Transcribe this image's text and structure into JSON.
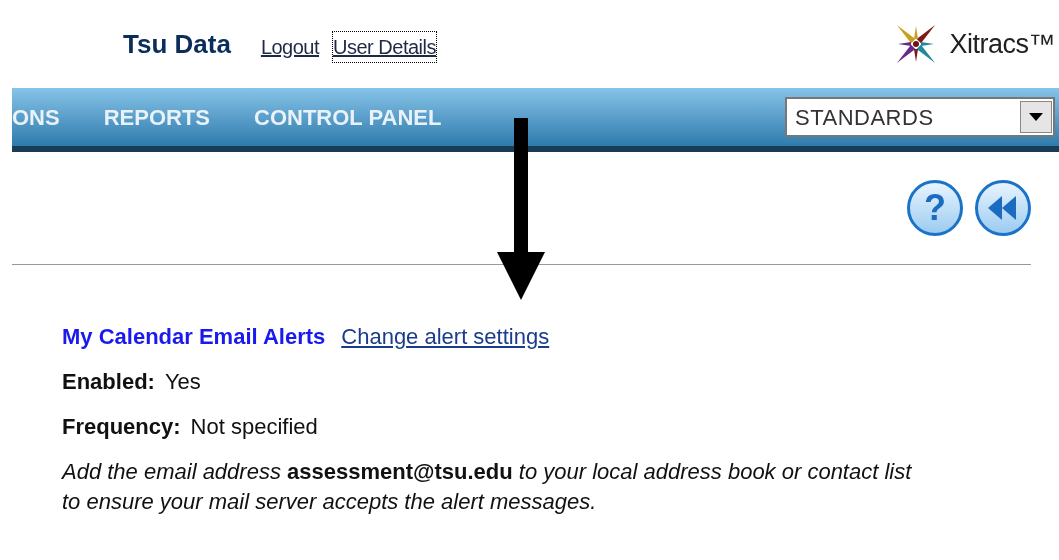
{
  "header": {
    "user": "Tsu Data",
    "links": [
      "Logout",
      "User Details"
    ],
    "logo": "Xitracs™"
  },
  "nav": {
    "items": [
      {
        "label": "ONS"
      },
      {
        "label": "REPORTS"
      },
      {
        "label": "CONTROL PANEL"
      }
    ],
    "select": {
      "value": "STANDARDS"
    }
  },
  "toolbar": {
    "buttons": [
      {
        "kind": "help",
        "label": "?"
      },
      {
        "kind": "back"
      }
    ]
  },
  "alerts": {
    "title": "My Calendar Email Alerts",
    "link": "Change alert settings",
    "fields": [
      {
        "label": "Enabled:",
        "value": "Yes"
      },
      {
        "label": "Frequency:",
        "value": "Not specified"
      }
    ],
    "note": [
      "Add the email address **assessment@tsu.edu** to your local address book or contact list",
      "to ensure your mail server accepts the alert messages."
    ]
  }
}
